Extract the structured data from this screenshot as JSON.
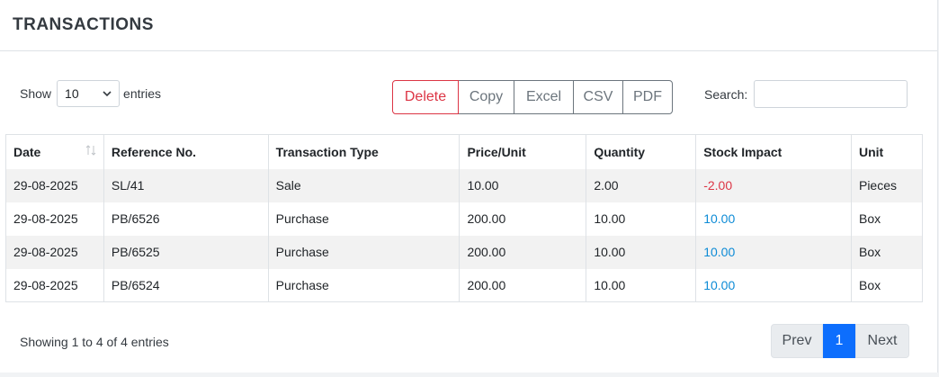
{
  "header": {
    "title": "TRANSACTIONS"
  },
  "length": {
    "label_show": "Show",
    "value": "10",
    "label_entries": "entries"
  },
  "buttons": {
    "delete": "Delete",
    "copy": "Copy",
    "excel": "Excel",
    "csv": "CSV",
    "pdf": "PDF"
  },
  "search": {
    "label": "Search:",
    "value": "",
    "placeholder": ""
  },
  "table": {
    "columns": [
      "Date",
      "Reference No.",
      "Transaction Type",
      "Price/Unit",
      "Quantity",
      "Stock Impact",
      "Unit"
    ],
    "rows": [
      [
        "29-08-2025",
        "SL/41",
        "Sale",
        "10.00",
        "2.00",
        "-2.00",
        "Pieces"
      ],
      [
        "29-08-2025",
        "PB/6526",
        "Purchase",
        "200.00",
        "10.00",
        "10.00",
        "Box"
      ],
      [
        "29-08-2025",
        "PB/6525",
        "Purchase",
        "200.00",
        "10.00",
        "10.00",
        "Box"
      ],
      [
        "29-08-2025",
        "PB/6524",
        "Purchase",
        "200.00",
        "10.00",
        "10.00",
        "Box"
      ]
    ]
  },
  "footer": {
    "info": "Showing 1 to 4 of 4 entries"
  },
  "pagination": {
    "prev": "Prev",
    "current": "1",
    "next": "Next"
  },
  "colors": {
    "negative": "#dc3545",
    "positive": "#0d8bd6",
    "accent": "#0d6efd",
    "stripe": "#f2f2f2"
  }
}
